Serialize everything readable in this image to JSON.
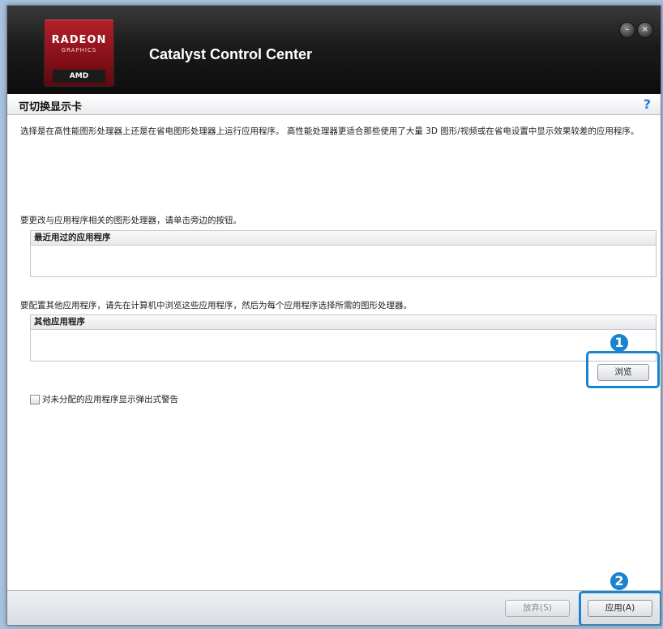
{
  "app": {
    "title": "Catalyst Control Center",
    "logo": {
      "brand": "RADEON",
      "sub": "GRAPHICS",
      "maker": "AMD"
    },
    "window_buttons": {
      "minimize": "–",
      "close": "×"
    }
  },
  "section": {
    "title": "可切换显示卡",
    "help": "?"
  },
  "description": "选择是在高性能图形处理器上还是在省电图形处理器上运行应用程序。 高性能处理器更适合那些使用了大量 3D 图形/视频或在省电设置中显示效果较差的应用程序。",
  "recent": {
    "instruction": "要更改与应用程序相关的图形处理器，请单击旁边的按钮。",
    "header": "最近用过的应用程序"
  },
  "other": {
    "instruction": "要配置其他应用程序，请先在计算机中浏览这些应用程序，然后为每个应用程序选择所需的图形处理器。",
    "header": "其他应用程序",
    "browse_label": "浏览"
  },
  "checkbox": {
    "label": "对未分配的应用程序显示弹出式警告",
    "checked": false
  },
  "footer": {
    "discard_label": "放弃(S)",
    "apply_label": "应用(A)"
  },
  "annotations": {
    "badge1": "1",
    "badge2": "2"
  },
  "colors": {
    "accent": "#1b84d0",
    "logo_red": "#b4202a"
  }
}
